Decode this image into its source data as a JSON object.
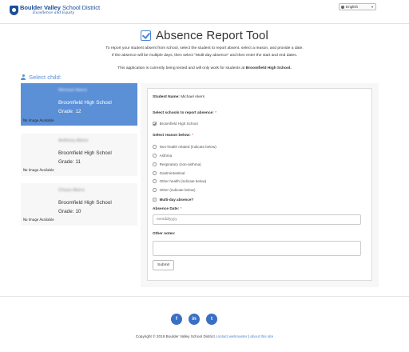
{
  "header": {
    "logo_name_bold": "Boulder Valley",
    "logo_name_thin": "School District",
    "logo_tagline": "Excellence and Equity",
    "language": "English"
  },
  "page": {
    "title": "Absence Report Tool",
    "intro_line1": "To report your student absent from school, select the student to report absent, select a reason, and provide a date.",
    "intro_line2": "If the absence will be multiple days, then select \"Multi-day absence\" and then enter the start and end dates.",
    "intro_line3_prefix": "This application is currently being tested and will only work for students at",
    "intro_line3_school": "Broomfield High School.",
    "select_child_label": "Select child:"
  },
  "students": [
    {
      "name": "Michael Akers",
      "no_image": "No Image Available",
      "school": "Broomfield High School",
      "grade": "Grade: 12"
    },
    {
      "name": "Anthony Akers",
      "no_image": "No Image Available",
      "school": "Broomfield High School",
      "grade": "Grade: 11"
    },
    {
      "name": "Chase Akers",
      "no_image": "No Image Available",
      "school": "Broomfield High School",
      "grade": "Grade: 10"
    }
  ],
  "form": {
    "student_name_label": "Student Name:",
    "student_name_value": "Michael Akers",
    "schools_label": "Select schools to report absence:",
    "school_option": "Broomfield High School",
    "reason_label": "Select reason below:",
    "reasons": [
      "Non-health related (indicate below)",
      "Asthma",
      "Respiratory (non-asthma)",
      "Gastrointestinal",
      "Other health (indicate below)",
      "Other (indicate below)"
    ],
    "multi_day_label": "Multi-day absence?",
    "absence_date_label": "Absence Date:",
    "date_placeholder": "mm/dd/yyyy",
    "other_notes_label": "Other notes:",
    "submit_label": "Submit",
    "required_mark": "*"
  },
  "footer": {
    "facebook": "f",
    "linkedin": "in",
    "twitter": "t",
    "copyright": "Copyright © 2019 Boulder Valley School District",
    "contact_link": "contact webmaster",
    "separator": "|",
    "about_link": "about this site"
  }
}
